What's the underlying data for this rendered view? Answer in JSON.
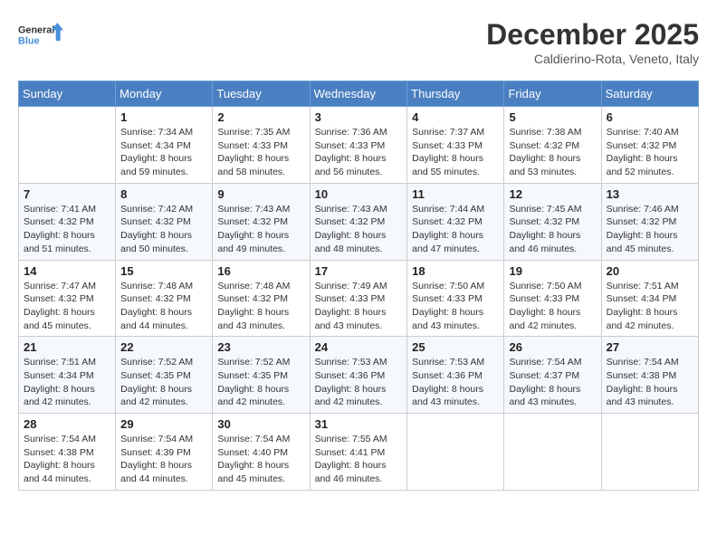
{
  "header": {
    "logo_line1": "General",
    "logo_line2": "Blue",
    "month": "December 2025",
    "location": "Caldierino-Rota, Veneto, Italy"
  },
  "weekdays": [
    "Sunday",
    "Monday",
    "Tuesday",
    "Wednesday",
    "Thursday",
    "Friday",
    "Saturday"
  ],
  "weeks": [
    [
      {
        "day": "",
        "info": ""
      },
      {
        "day": "1",
        "info": "Sunrise: 7:34 AM\nSunset: 4:34 PM\nDaylight: 8 hours\nand 59 minutes."
      },
      {
        "day": "2",
        "info": "Sunrise: 7:35 AM\nSunset: 4:33 PM\nDaylight: 8 hours\nand 58 minutes."
      },
      {
        "day": "3",
        "info": "Sunrise: 7:36 AM\nSunset: 4:33 PM\nDaylight: 8 hours\nand 56 minutes."
      },
      {
        "day": "4",
        "info": "Sunrise: 7:37 AM\nSunset: 4:33 PM\nDaylight: 8 hours\nand 55 minutes."
      },
      {
        "day": "5",
        "info": "Sunrise: 7:38 AM\nSunset: 4:32 PM\nDaylight: 8 hours\nand 53 minutes."
      },
      {
        "day": "6",
        "info": "Sunrise: 7:40 AM\nSunset: 4:32 PM\nDaylight: 8 hours\nand 52 minutes."
      }
    ],
    [
      {
        "day": "7",
        "info": "Sunrise: 7:41 AM\nSunset: 4:32 PM\nDaylight: 8 hours\nand 51 minutes."
      },
      {
        "day": "8",
        "info": "Sunrise: 7:42 AM\nSunset: 4:32 PM\nDaylight: 8 hours\nand 50 minutes."
      },
      {
        "day": "9",
        "info": "Sunrise: 7:43 AM\nSunset: 4:32 PM\nDaylight: 8 hours\nand 49 minutes."
      },
      {
        "day": "10",
        "info": "Sunrise: 7:43 AM\nSunset: 4:32 PM\nDaylight: 8 hours\nand 48 minutes."
      },
      {
        "day": "11",
        "info": "Sunrise: 7:44 AM\nSunset: 4:32 PM\nDaylight: 8 hours\nand 47 minutes."
      },
      {
        "day": "12",
        "info": "Sunrise: 7:45 AM\nSunset: 4:32 PM\nDaylight: 8 hours\nand 46 minutes."
      },
      {
        "day": "13",
        "info": "Sunrise: 7:46 AM\nSunset: 4:32 PM\nDaylight: 8 hours\nand 45 minutes."
      }
    ],
    [
      {
        "day": "14",
        "info": "Sunrise: 7:47 AM\nSunset: 4:32 PM\nDaylight: 8 hours\nand 45 minutes."
      },
      {
        "day": "15",
        "info": "Sunrise: 7:48 AM\nSunset: 4:32 PM\nDaylight: 8 hours\nand 44 minutes."
      },
      {
        "day": "16",
        "info": "Sunrise: 7:48 AM\nSunset: 4:32 PM\nDaylight: 8 hours\nand 43 minutes."
      },
      {
        "day": "17",
        "info": "Sunrise: 7:49 AM\nSunset: 4:33 PM\nDaylight: 8 hours\nand 43 minutes."
      },
      {
        "day": "18",
        "info": "Sunrise: 7:50 AM\nSunset: 4:33 PM\nDaylight: 8 hours\nand 43 minutes."
      },
      {
        "day": "19",
        "info": "Sunrise: 7:50 AM\nSunset: 4:33 PM\nDaylight: 8 hours\nand 42 minutes."
      },
      {
        "day": "20",
        "info": "Sunrise: 7:51 AM\nSunset: 4:34 PM\nDaylight: 8 hours\nand 42 minutes."
      }
    ],
    [
      {
        "day": "21",
        "info": "Sunrise: 7:51 AM\nSunset: 4:34 PM\nDaylight: 8 hours\nand 42 minutes."
      },
      {
        "day": "22",
        "info": "Sunrise: 7:52 AM\nSunset: 4:35 PM\nDaylight: 8 hours\nand 42 minutes."
      },
      {
        "day": "23",
        "info": "Sunrise: 7:52 AM\nSunset: 4:35 PM\nDaylight: 8 hours\nand 42 minutes."
      },
      {
        "day": "24",
        "info": "Sunrise: 7:53 AM\nSunset: 4:36 PM\nDaylight: 8 hours\nand 42 minutes."
      },
      {
        "day": "25",
        "info": "Sunrise: 7:53 AM\nSunset: 4:36 PM\nDaylight: 8 hours\nand 43 minutes."
      },
      {
        "day": "26",
        "info": "Sunrise: 7:54 AM\nSunset: 4:37 PM\nDaylight: 8 hours\nand 43 minutes."
      },
      {
        "day": "27",
        "info": "Sunrise: 7:54 AM\nSunset: 4:38 PM\nDaylight: 8 hours\nand 43 minutes."
      }
    ],
    [
      {
        "day": "28",
        "info": "Sunrise: 7:54 AM\nSunset: 4:38 PM\nDaylight: 8 hours\nand 44 minutes."
      },
      {
        "day": "29",
        "info": "Sunrise: 7:54 AM\nSunset: 4:39 PM\nDaylight: 8 hours\nand 44 minutes."
      },
      {
        "day": "30",
        "info": "Sunrise: 7:54 AM\nSunset: 4:40 PM\nDaylight: 8 hours\nand 45 minutes."
      },
      {
        "day": "31",
        "info": "Sunrise: 7:55 AM\nSunset: 4:41 PM\nDaylight: 8 hours\nand 46 minutes."
      },
      {
        "day": "",
        "info": ""
      },
      {
        "day": "",
        "info": ""
      },
      {
        "day": "",
        "info": ""
      }
    ]
  ]
}
